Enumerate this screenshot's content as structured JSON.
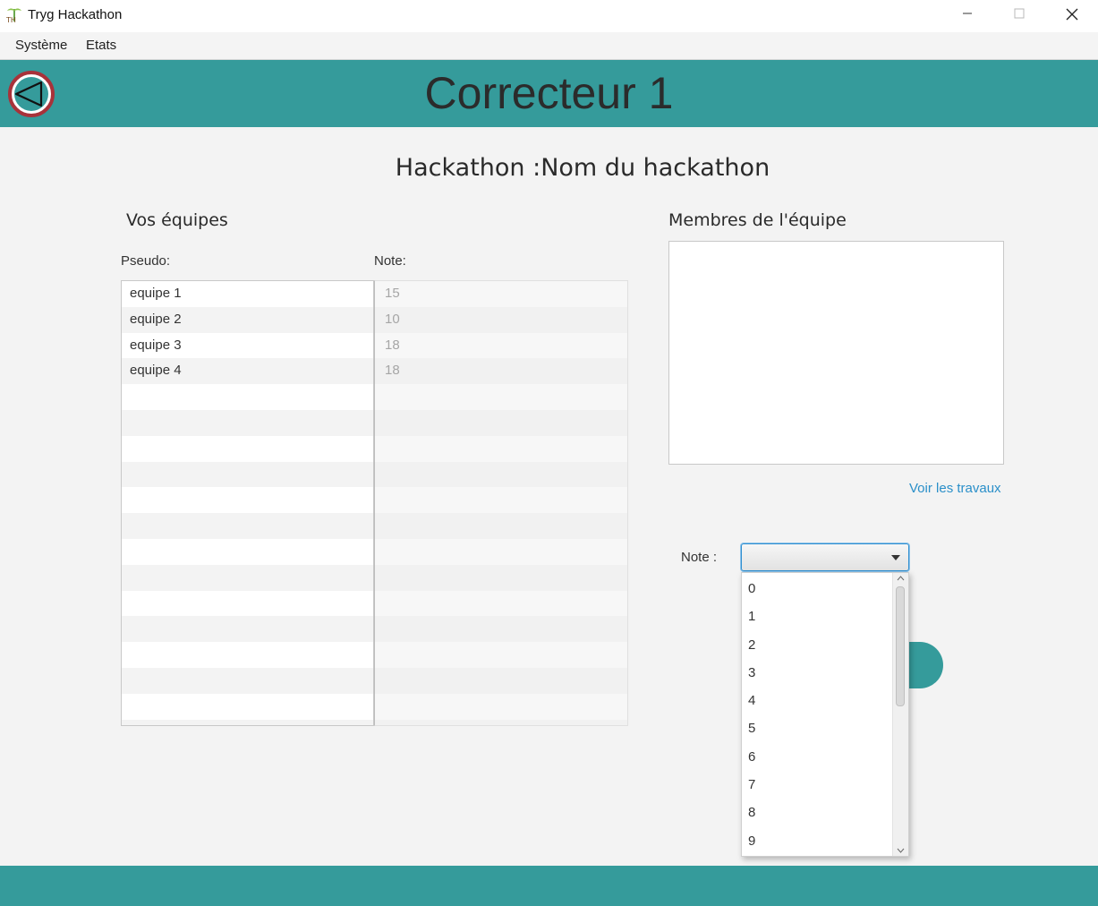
{
  "window": {
    "title": "Tryg Hackathon",
    "icon_text": "TH"
  },
  "menu": {
    "items": [
      "Système",
      "Etats"
    ]
  },
  "header": {
    "title": "Correcteur 1",
    "back_icon": "back-arrow-icon"
  },
  "hackathon": {
    "title": "Hackathon :Nom du hackathon"
  },
  "teams_section": {
    "title": "Vos équipes",
    "pseudo_label": "Pseudo:",
    "note_label": "Note:",
    "teams": [
      {
        "pseudo": "equipe 1",
        "note": "15"
      },
      {
        "pseudo": "equipe 2",
        "note": "10"
      },
      {
        "pseudo": "equipe 3",
        "note": "18"
      },
      {
        "pseudo": "equipe 4",
        "note": "18"
      }
    ]
  },
  "members_section": {
    "title": "Membres de l'équipe",
    "members": []
  },
  "actions": {
    "view_work_link": "Voir les travaux",
    "note_label": "Note :",
    "note_selected": "",
    "note_options": [
      "0",
      "1",
      "2",
      "3",
      "4",
      "5",
      "6",
      "7",
      "8",
      "9"
    ]
  },
  "colors": {
    "teal": "#359b9b",
    "link": "#2a8fc9",
    "back_ring": "#a8323a"
  }
}
